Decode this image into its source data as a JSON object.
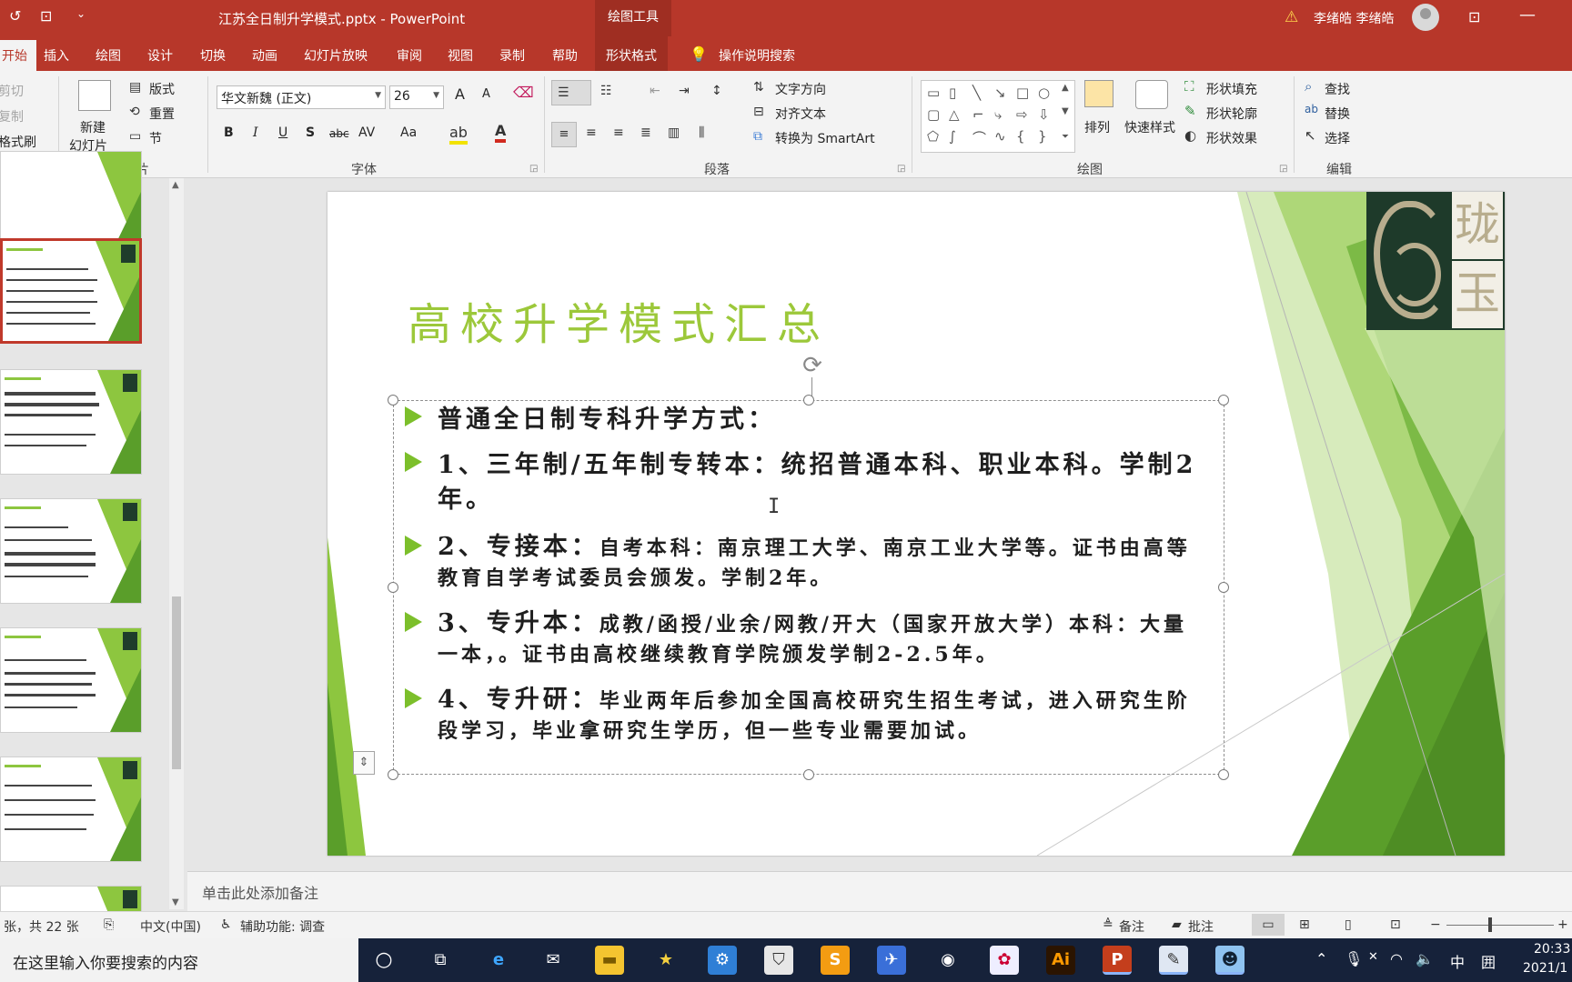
{
  "titlebar": {
    "doc_title": "江苏全日制升学模式.pptx  -  PowerPoint",
    "context_band": "绘图工具",
    "user_name": "李绪皓 李绪皓",
    "qa_undo": "↺",
    "qa_present": "⊡",
    "qa_more": "⌄",
    "ribbon_display": "⊡",
    "minimize": "—"
  },
  "tabs": {
    "home": "开始",
    "insert": "插入",
    "draw": "绘图",
    "design": "设计",
    "transitions": "切换",
    "animations": "动画",
    "slideshow": "幻灯片放映",
    "review": "审阅",
    "view": "视图",
    "record": "录制",
    "help": "帮助",
    "shape_format": "形状格式",
    "tell_me": "操作说明搜索"
  },
  "ribbon": {
    "clipboard": {
      "cut": "剪切",
      "copy": "复制",
      "format_painter": "格式刷"
    },
    "slides": {
      "new_slide_1": "新建",
      "new_slide_2": "幻灯片",
      "layout": "版式",
      "reset": "重置",
      "section": "节",
      "label": "幻灯片"
    },
    "font": {
      "family": "华文新魏 (正文)",
      "size": "26",
      "label": "字体",
      "bold": "B",
      "italic": "I",
      "underline": "U",
      "shadow": "S",
      "strike": "abc",
      "spacing": "AV",
      "case": "Aa",
      "grow": "A",
      "shrink": "A"
    },
    "paragraph": {
      "text_direction": "文字方向",
      "align_text": "对齐文本",
      "smartart": "转换为 SmartArt",
      "label": "段落"
    },
    "drawing": {
      "arrange": "排列",
      "quick_styles": "快速样式",
      "fill": "形状填充",
      "outline": "形状轮廓",
      "effects": "形状效果",
      "label": "绘图"
    },
    "editing": {
      "find": "查找",
      "replace": "替换",
      "select": "选择",
      "label": "编辑"
    }
  },
  "slide": {
    "title": "高校升学模式汇总",
    "bullets": [
      {
        "text": "普通全日制专科升学方式："
      },
      {
        "text": "1、三年制/五年制专转本：统招普通本科、职业本科。学制2年。"
      },
      {
        "lead": "2、专接本：",
        "text": "自考本科：南京理工大学、南京工业大学等。证书由高等教育自学考试委员会颁发。学制2年。"
      },
      {
        "lead": "3、专升本：",
        "text": "成教/函授/业余/网教/开大（国家开放大学）本科：大量一本，。证书由高校继续教育学院颁发学制2-2.5年。"
      },
      {
        "lead": "4、专升研：",
        "text": "毕业两年后参加全国高校研究生招生考试，进入研究生阶段学习，毕业拿研究生学历，但一些专业需要加试。"
      }
    ],
    "logo_char_1": "珑",
    "logo_char_2": "玉",
    "accent": "#8dc63f",
    "accent_dark": "#5a9e2a"
  },
  "notes": {
    "placeholder": "单击此处添加备注"
  },
  "statusbar": {
    "slide_count": "张，共 22 张",
    "language": "中文(中国)",
    "accessibility": "辅助功能: 调查",
    "notes_btn": "备注",
    "comments_btn": "批注"
  },
  "taskbar": {
    "search_placeholder": "在这里输入你要搜索的内容",
    "ime_lang": "中",
    "ime_grid": "囲",
    "clock_time": "20:33",
    "clock_date": "2021/1"
  }
}
